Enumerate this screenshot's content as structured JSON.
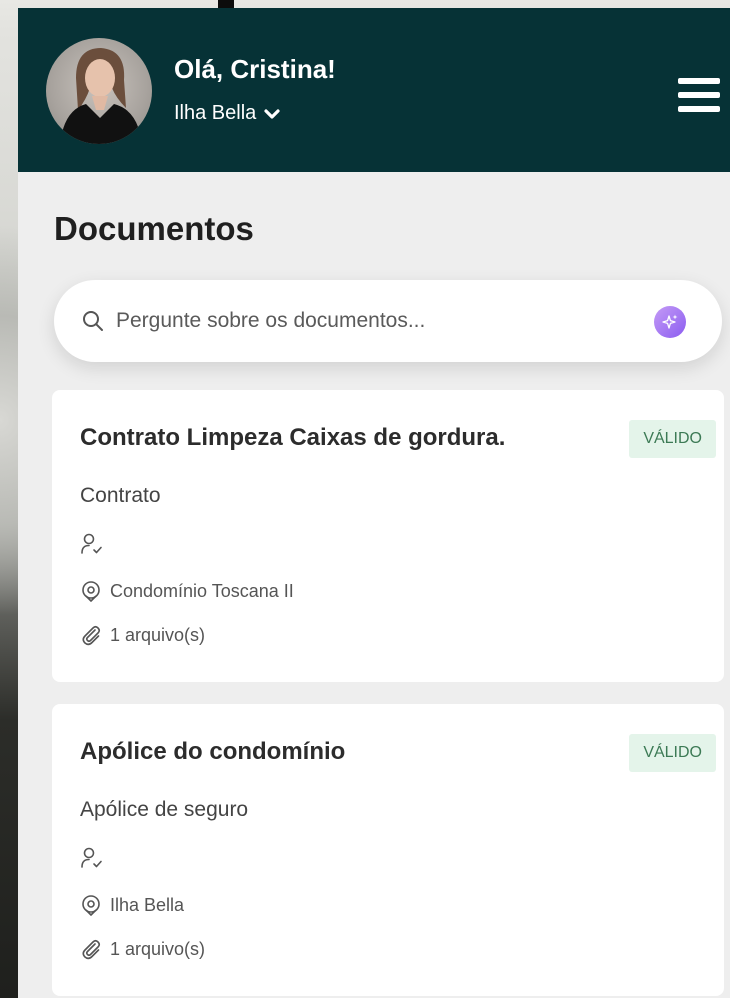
{
  "header": {
    "greeting": "Olá, Cristina!",
    "condominium": "Ilha Bella"
  },
  "page": {
    "title": "Documentos"
  },
  "search": {
    "placeholder": "Pergunte sobre os documentos..."
  },
  "documents": [
    {
      "title": "Contrato Limpeza Caixas de gordura.",
      "status": "VÁLIDO",
      "type": "Contrato",
      "location": "Condomínio Toscana II",
      "files": "1 arquivo(s)"
    },
    {
      "title": "Apólice do condomínio",
      "status": "VÁLIDO",
      "type": "Apólice de seguro",
      "location": "Ilha Bella",
      "files": "1 arquivo(s)"
    }
  ],
  "colors": {
    "header_bg": "#063236",
    "badge_bg": "#e4f4ea",
    "badge_text": "#3c7a55",
    "ai_accent": "#8b5cf0"
  }
}
